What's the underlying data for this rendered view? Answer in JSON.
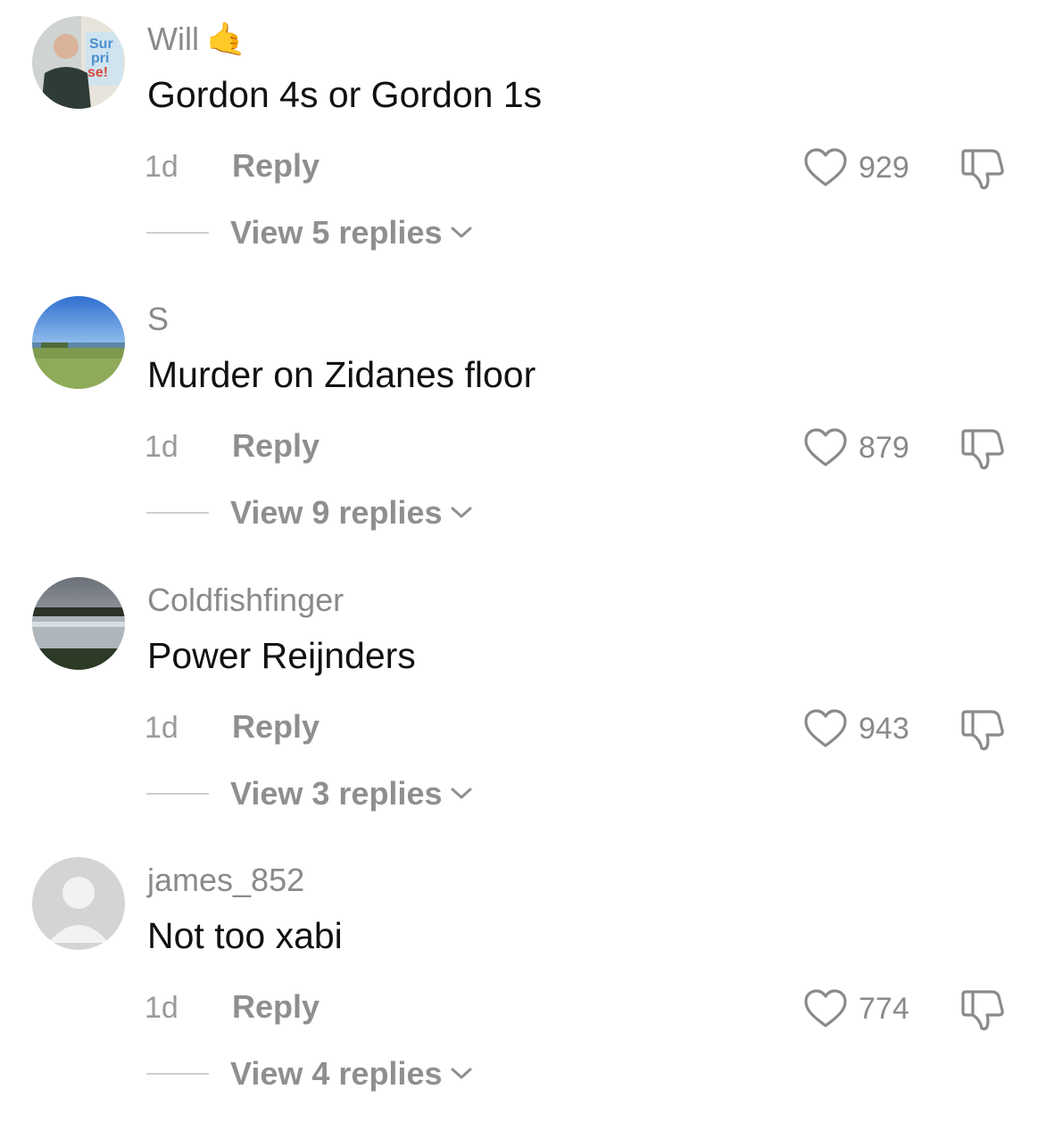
{
  "comments": [
    {
      "username": "Will",
      "username_emoji": "🤙",
      "text": "Gordon 4s or Gordon 1s",
      "time": "1d",
      "reply_label": "Reply",
      "likes": "929",
      "view_replies": "View 5 replies",
      "avatar": "person-photo"
    },
    {
      "username": "S",
      "username_emoji": "",
      "text": "Murder on Zidanes floor",
      "time": "1d",
      "reply_label": "Reply",
      "likes": "879",
      "view_replies": "View 9 replies",
      "avatar": "landscape-field"
    },
    {
      "username": "Coldfishfinger",
      "username_emoji": "",
      "text": "Power Reijnders",
      "time": "1d",
      "reply_label": "Reply",
      "likes": "943",
      "view_replies": "View 3 replies",
      "avatar": "landscape-lake"
    },
    {
      "username": "james_852",
      "username_emoji": "",
      "text": "Not too xabi",
      "time": "1d",
      "reply_label": "Reply",
      "likes": "774",
      "view_replies": "View 4 replies",
      "avatar": "default-user"
    }
  ],
  "colors": {
    "username": "#8a8a8a",
    "text": "#111111",
    "muted": "#9a9a9a"
  },
  "icons": [
    "heart-outline-icon",
    "thumbs-down-icon",
    "chevron-down-icon"
  ]
}
